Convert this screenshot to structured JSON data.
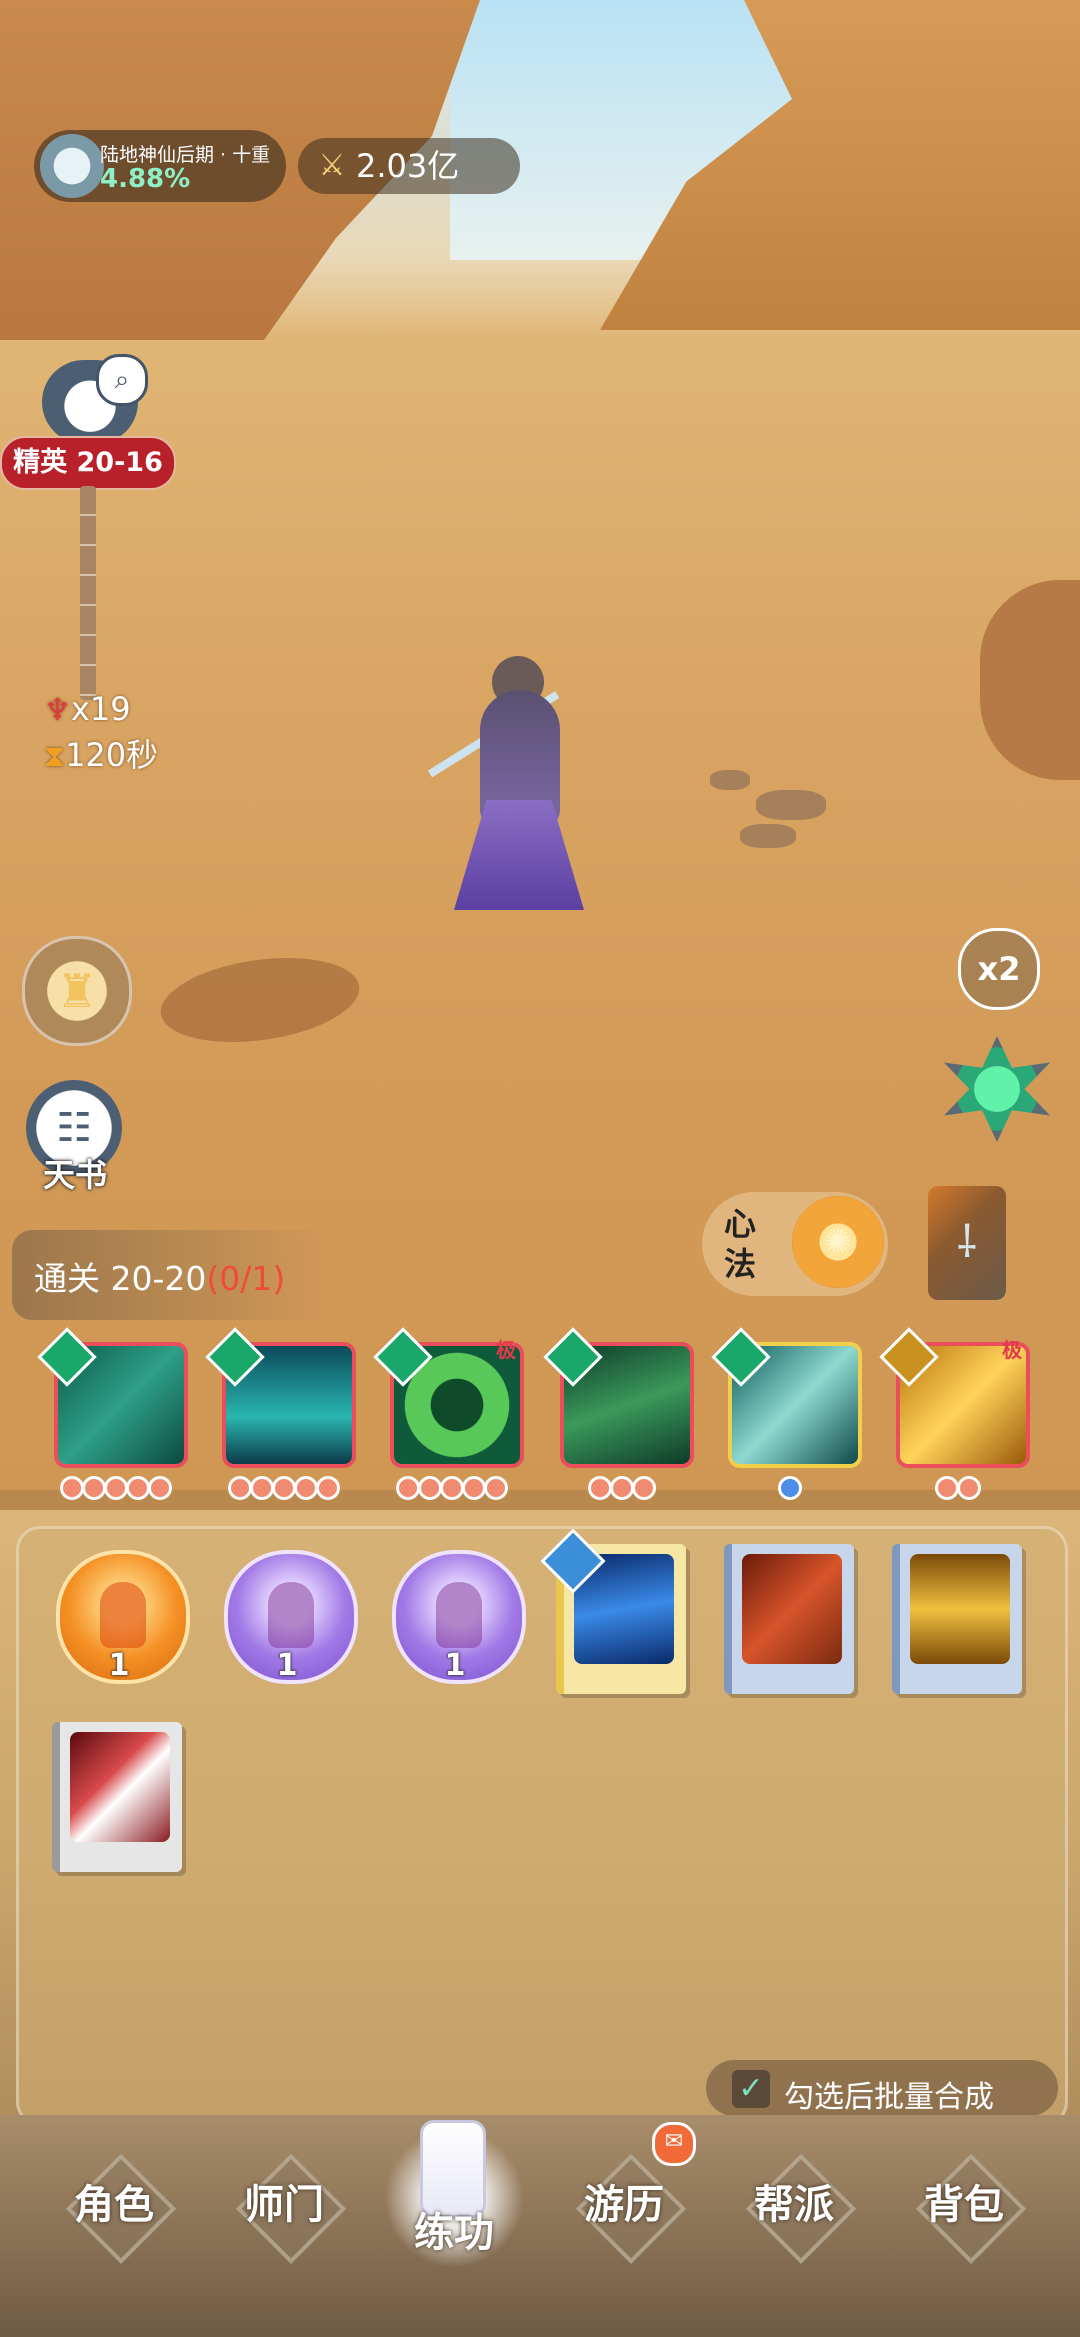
{
  "hud": {
    "realm_name": "陆地神仙后期 · 十重",
    "realm_percent": "4.88%",
    "power_value": "2.03亿"
  },
  "stage": {
    "elite_label": "精英 20-16",
    "enemy_count": "x19",
    "timer": "120秒"
  },
  "side_left": {
    "tianshu_label": "天书"
  },
  "clear": {
    "prefix": "通关 20-20",
    "progress": "(0/1)"
  },
  "side_right": {
    "speed_label": "x2",
    "xinfa_label": "心法"
  },
  "skill_cards": [
    {
      "name": "fan",
      "tier": "green",
      "pips": 5,
      "ji": ""
    },
    {
      "name": "cup",
      "tier": "green",
      "pips": 5,
      "ji": ""
    },
    {
      "name": "ring",
      "tier": "green",
      "pips": 5,
      "ji": "极"
    },
    {
      "name": "leaf",
      "tier": "green",
      "pips": 3,
      "ji": ""
    },
    {
      "name": "sword-scroll",
      "tier": "green",
      "pips": 1,
      "ji": ""
    },
    {
      "name": "golden-blade",
      "tier": "gold",
      "pips": 2,
      "ji": "极"
    }
  ],
  "inventory": {
    "orbs": [
      {
        "color": "orange",
        "count": "1"
      },
      {
        "color": "purple",
        "count": "1"
      },
      {
        "color": "purple",
        "count": "1"
      }
    ],
    "books": [
      "blue-lightning",
      "red-blade",
      "golden-sword",
      "red-slash"
    ]
  },
  "batch_merge": {
    "label": "勾选后批量合成",
    "checked": true
  },
  "nav": {
    "tabs": [
      {
        "label": "角色"
      },
      {
        "label": "师门"
      },
      {
        "label": "练功"
      },
      {
        "label": "游历"
      },
      {
        "label": "帮派"
      },
      {
        "label": "背包"
      }
    ],
    "active": "练功"
  },
  "colors": {
    "elite_red": "#b8202a",
    "progress_red": "#f24a3a",
    "realm_green": "#8ff0c8",
    "card_border": "#e94e5a",
    "tier_green": "#1aa86a",
    "tier_gold": "#c99220"
  }
}
